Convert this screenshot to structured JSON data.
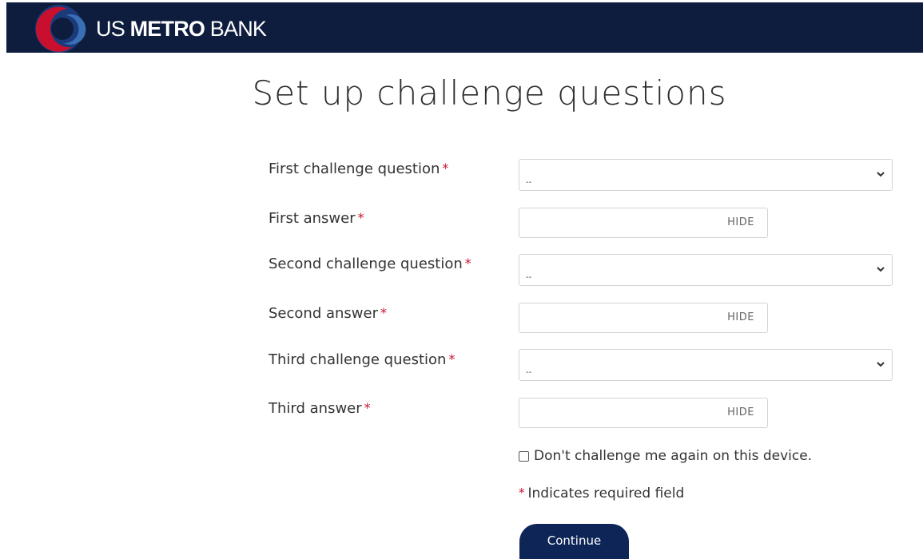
{
  "header": {
    "brand_prefix": "US ",
    "brand_bold": "METRO",
    "brand_suffix": " BANK",
    "colors": {
      "background": "#0e1c3d",
      "logo_red": "#c8102e",
      "logo_blue": "#3a6fb5"
    }
  },
  "page_title": "Set up challenge questions",
  "form": {
    "required_marker": "*",
    "q1_label": "First challenge question",
    "q1_value": "--",
    "a1_label": "First answer",
    "a1_hide": "HIDE",
    "q2_label": "Second challenge question",
    "q2_value": "--",
    "a2_label": "Second answer",
    "a2_hide": "HIDE",
    "q3_label": "Third challenge question",
    "q3_value": "--",
    "a3_label": "Third answer",
    "a3_hide": "HIDE",
    "remember_label": "Don't challenge me again on this device.",
    "required_note": "Indicates required field",
    "continue_label": "Continue"
  },
  "icons": {
    "logo": "metro-bank-logo-icon",
    "dropdown": "chevron-down-icon",
    "checkbox": "checkbox-unchecked-icon"
  }
}
